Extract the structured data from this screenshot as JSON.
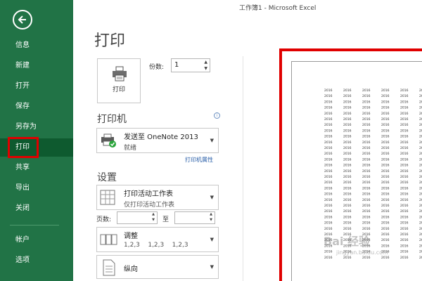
{
  "window": {
    "title": "工作簿1 - Microsoft Excel"
  },
  "sidebar": {
    "items": [
      {
        "label": "信息"
      },
      {
        "label": "新建"
      },
      {
        "label": "打开"
      },
      {
        "label": "保存"
      },
      {
        "label": "另存为"
      },
      {
        "label": "打印"
      },
      {
        "label": "共享"
      },
      {
        "label": "导出"
      },
      {
        "label": "关闭"
      },
      {
        "label": "帐户"
      },
      {
        "label": "选项"
      }
    ],
    "active": "打印"
  },
  "main": {
    "title": "打印",
    "print_button_label": "打印",
    "copies_label": "份数:",
    "copies_value": "1",
    "printer_section": "打印机",
    "printer_name": "发送至 OneNote 2013",
    "printer_status": "就绪",
    "printer_properties": "打印机属性",
    "settings_section": "设置",
    "setting_scope_title": "打印活动工作表",
    "setting_scope_sub": "仅打印活动工作表",
    "pages_label": "页数:",
    "to_label": "至",
    "collate_title": "调整",
    "collate_sub": "1,2,3    1,2,3    1,2,3",
    "orientation_title": "纵向"
  },
  "preview": {
    "cell_text": "2016"
  },
  "watermark": {
    "text": "Bai 经验",
    "sub": "jingyan.baidu.com"
  },
  "colors": {
    "sidebar": "#217346",
    "highlight": "#e00000",
    "link": "#2a5fa8"
  }
}
